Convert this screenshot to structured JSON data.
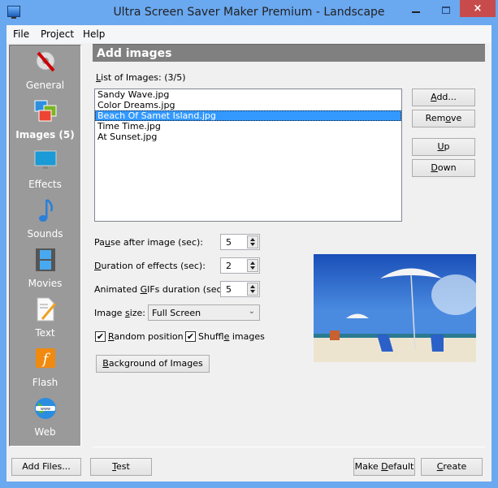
{
  "window": {
    "title": "Ultra Screen Saver Maker Premium - Landscape",
    "close_glyph": "×"
  },
  "menu": [
    "File",
    "Project",
    "Help"
  ],
  "sidebar": {
    "items": [
      {
        "label": "General",
        "icon": "gear-wrench-icon"
      },
      {
        "label": "Images (5)",
        "icon": "images-icon",
        "selected": true
      },
      {
        "label": "Effects",
        "icon": "monitor-icon"
      },
      {
        "label": "Sounds",
        "icon": "music-note-icon"
      },
      {
        "label": "Movies",
        "icon": "film-icon"
      },
      {
        "label": "Text",
        "icon": "document-pencil-icon"
      },
      {
        "label": "Flash",
        "icon": "flash-icon"
      },
      {
        "label": "Web",
        "icon": "globe-www-icon"
      }
    ]
  },
  "header": {
    "title": "Add images"
  },
  "list": {
    "label_prefix": "L",
    "label_rest": "ist of Images:  (3/5)",
    "items": [
      "Sandy Wave.jpg",
      "Color Dreams.jpg",
      "Beach Of Samet Island.jpg",
      "Time Time.jpg",
      "At Sunset.jpg"
    ],
    "selected_index": 2
  },
  "list_buttons": {
    "add": {
      "u": "A",
      "rest": "dd..."
    },
    "remove": {
      "pre": "Rem",
      "u": "o",
      "rest": "ve"
    },
    "up": {
      "u": "U",
      "rest": "p"
    },
    "down": {
      "u": "D",
      "rest": "own"
    }
  },
  "fields": {
    "pause": {
      "pre": "Pa",
      "u": "u",
      "rest": "se after image (sec):",
      "value": "5"
    },
    "duration": {
      "pre": "",
      "u": "D",
      "rest": "uration of effects (sec):",
      "value": "2"
    },
    "gifs": {
      "pre": "Animated ",
      "u": "G",
      "rest": "IFs duration (sec):",
      "value": "5"
    },
    "size": {
      "pre": "Image ",
      "u": "s",
      "rest": "ize:",
      "value": "Full Screen",
      "chevron": "⌄"
    }
  },
  "checkboxes": {
    "random": {
      "u": "R",
      "rest": "andom position",
      "checked": true,
      "mark": "✔"
    },
    "shuffle": {
      "pre": "Shuffl",
      "u": "e",
      "rest": " images",
      "checked": true,
      "mark": "✔"
    }
  },
  "background_button": {
    "u": "B",
    "rest": "ackground of Images"
  },
  "preview": {
    "alt": "beach-preview"
  },
  "footer": {
    "add_files": "Add Files...",
    "test": {
      "u": "T",
      "rest": "est"
    },
    "make_default": {
      "pre": "Make ",
      "u": "D",
      "rest": "efault"
    },
    "create": {
      "u": "C",
      "rest": "reate"
    }
  }
}
